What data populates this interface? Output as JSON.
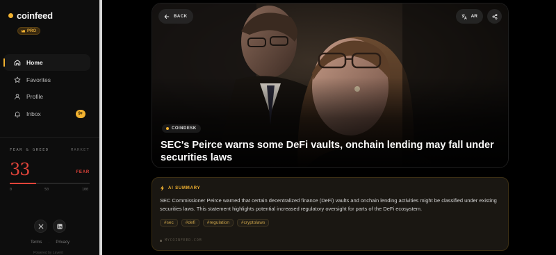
{
  "brand": {
    "name": "coinfeed",
    "badge": "PRO"
  },
  "nav": {
    "items": [
      {
        "label": "Home",
        "icon": "home-icon",
        "active": true
      },
      {
        "label": "Favorites",
        "icon": "star-icon"
      },
      {
        "label": "Profile",
        "icon": "user-icon"
      },
      {
        "label": "Inbox",
        "icon": "bell-icon",
        "badge": "9+"
      }
    ]
  },
  "fear_greed": {
    "label": "FEAR & GREED",
    "market": "MARKET",
    "value": "33",
    "status": "FEAR",
    "level": 0.33,
    "ticks": [
      "0",
      "50",
      "100"
    ]
  },
  "footer": {
    "socials": [
      "x-icon",
      "linkedin-icon"
    ],
    "terms": "Terms",
    "separator": "·",
    "privacy": "Privacy",
    "powered": "Powered by Lavent"
  },
  "article": {
    "back_label": "BACK",
    "lang_label": "AR",
    "source": "COINDESK",
    "headline": "SEC's Peirce warns some DeFi vaults, onchain lending may fall under securities laws"
  },
  "summary": {
    "title": "AI SUMMARY",
    "text": "SEC Commissioner Peirce warned that certain decentralized finance (DeFi) vaults and onchain lending activities might be classified under existing securities laws. This statement highlights potential increased regulatory oversight for parts of the DeFi ecosystem.",
    "tags": [
      "#sec",
      "#defi",
      "#regulation",
      "#cryptolaws"
    ],
    "footer": "MYCOINFEED.COM"
  },
  "colors": {
    "accent": "#f2b230",
    "fear": "#e2443a"
  }
}
